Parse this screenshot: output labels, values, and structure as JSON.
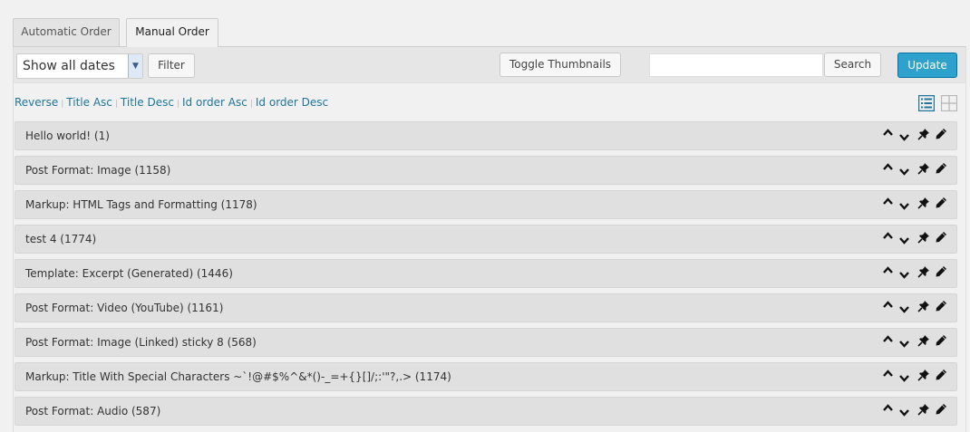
{
  "tabs": [
    {
      "label": "Automatic Order"
    },
    {
      "label": "Manual Order"
    }
  ],
  "toolbar": {
    "date_select": "Show all dates",
    "filter_label": "Filter",
    "toggle_label": "Toggle Thumbnails",
    "search_value": "",
    "search_label": "Search",
    "update_label": "Update"
  },
  "sort_links": [
    "Reverse",
    "Title Asc",
    "Title Desc",
    "Id order Asc",
    "Id order Desc"
  ],
  "view_icons": {
    "list": "list-view-icon",
    "grid": "grid-view-icon"
  },
  "colors": {
    "accent": "#2ea2cc",
    "link": "#21759b",
    "active_view": "#21759b"
  },
  "items": [
    {
      "title": "Hello world! (1)"
    },
    {
      "title": "Post Format: Image (1158)"
    },
    {
      "title": "Markup: HTML Tags and Formatting (1178)"
    },
    {
      "title": "test 4 (1774)"
    },
    {
      "title": "Template: Excerpt (Generated) (1446)"
    },
    {
      "title": "Post Format: Video (YouTube) (1161)"
    },
    {
      "title": "Post Format: Image (Linked) sticky 8 (568)"
    },
    {
      "title": "Markup: Title With Special Characters ~`!@#$%^&*()-_=+{}[]/;:'\"?,.> (1174)"
    },
    {
      "title": "Post Format: Audio (587)"
    }
  ],
  "row_icons": [
    "chevron-up-icon",
    "chevron-down-icon",
    "pin-icon",
    "pencil-icon"
  ]
}
